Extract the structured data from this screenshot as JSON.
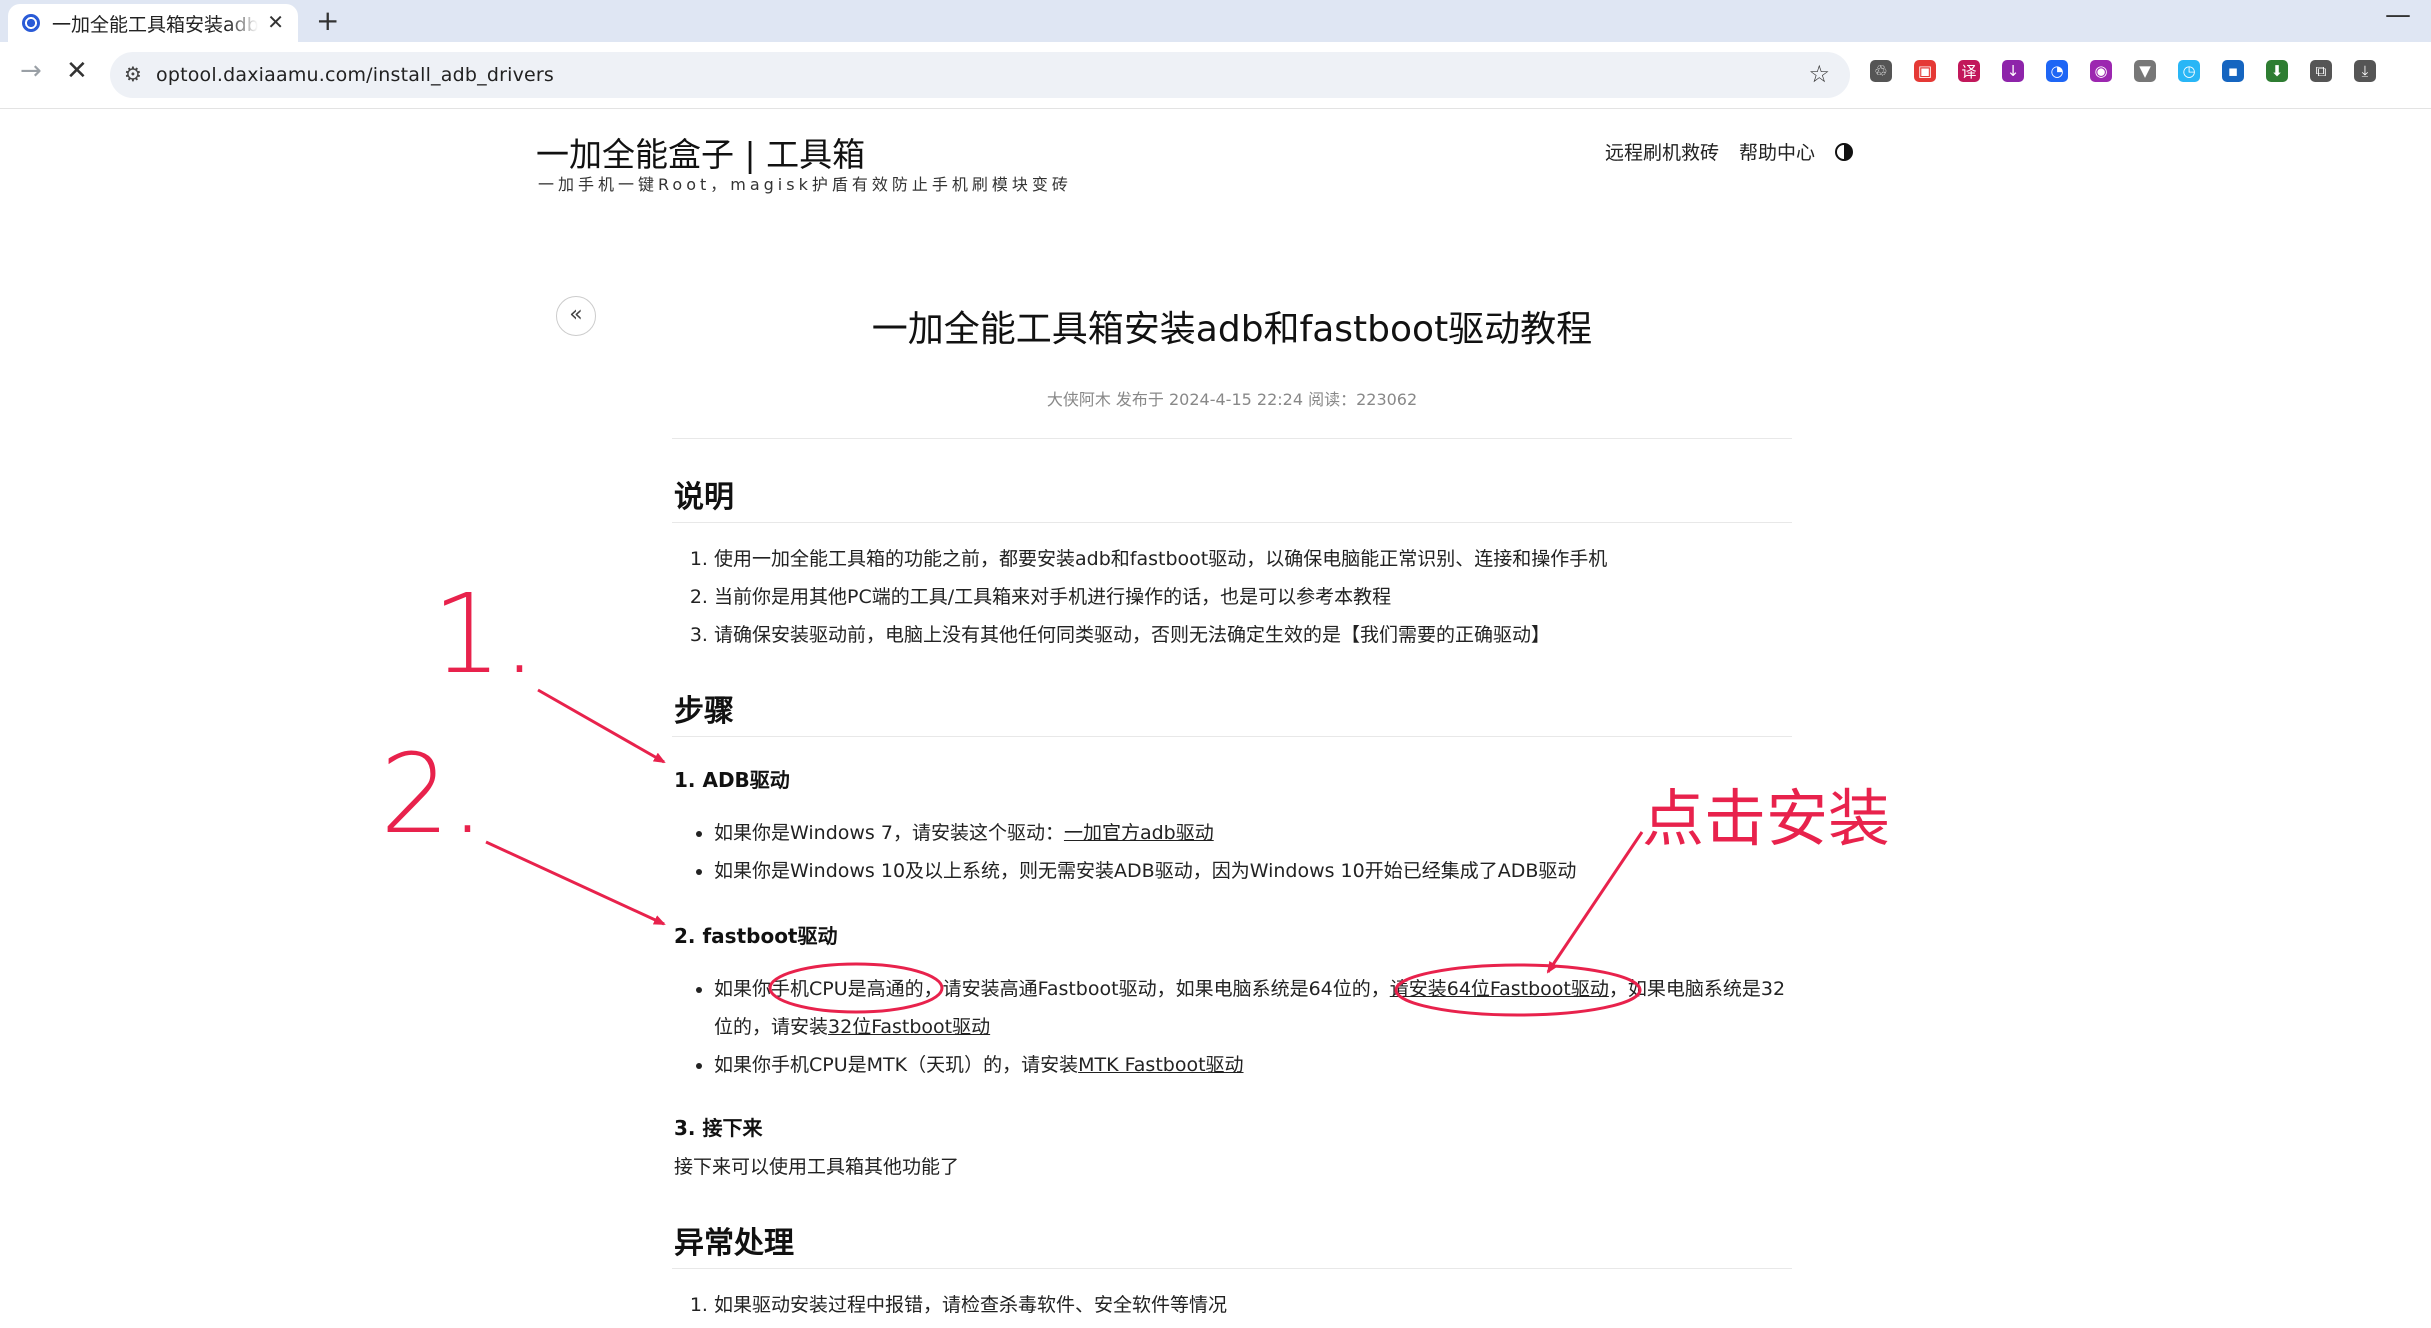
{
  "browser": {
    "tab_title": "一加全能工具箱安装adb和fastboot驱动教程",
    "tab_close": "✕",
    "new_tab": "+",
    "minimize": "—",
    "forward": "→",
    "stop": "✕",
    "site_info_icon": "⚙",
    "url": "optool.daxiaamu.com/install_adb_drivers",
    "bookmark_star": "☆",
    "extensions": [
      {
        "name": "puzzle-recycle-icon",
        "color": "#555555",
        "glyph": "♲"
      },
      {
        "name": "dice-icon",
        "color": "#e53935",
        "glyph": "▣"
      },
      {
        "name": "translate-icon",
        "color": "#c2185b",
        "glyph": "译"
      },
      {
        "name": "download-arrow-icon",
        "color": "#8e24aa",
        "glyph": "↓"
      },
      {
        "name": "chat-icon",
        "color": "#1e66f5",
        "glyph": "◔"
      },
      {
        "name": "globe-icon",
        "color": "#9c27b0",
        "glyph": "◉"
      },
      {
        "name": "vpn-icon",
        "color": "#777777",
        "glyph": "▼"
      },
      {
        "name": "speed-icon",
        "color": "#29b6f6",
        "glyph": "◷"
      },
      {
        "name": "squares-icon",
        "color": "#1565c0",
        "glyph": "▪"
      },
      {
        "name": "green-download-icon",
        "color": "#2e7d32",
        "glyph": "⬇"
      },
      {
        "name": "extensions-icon",
        "color": "#555555",
        "glyph": "⧉"
      },
      {
        "name": "downloads-icon",
        "color": "#555555",
        "glyph": "⤓"
      }
    ]
  },
  "site": {
    "title": "一加全能盒子 | 工具箱",
    "subtitle": "一加手机一键Root，magisk护盾有效防止手机刷模块变砖",
    "nav": [
      "远程刷机救砖",
      "帮助中心"
    ]
  },
  "article": {
    "back": "«",
    "title": "一加全能工具箱安装adb和fastboot驱动教程",
    "meta": "大侠阿木 发布于 2024-4-15 22:24  阅读：223062",
    "section_intro": "说明",
    "intro_items": [
      "使用一加全能工具箱的功能之前，都要安装adb和fastboot驱动，以确保电脑能正常识别、连接和操作手机",
      "当前你是用其他PC端的工具/工具箱来对手机进行操作的话，也是可以参考本教程",
      "请确保安装驱动前，电脑上没有其他任何同类驱动，否则无法确定生效的是【我们需要的正确驱动】"
    ],
    "section_steps": "步骤",
    "step1_title": "1. ADB驱动",
    "step1_a_text": "如果你是Windows 7，请安装这个驱动：",
    "step1_a_link": "一加官方adb驱动",
    "step1_b_text": "如果你是Windows 10及以上系统，则无需安装ADB驱动，因为Windows 10开始已经集成了ADB驱动",
    "step2_title": "2. fastboot驱动",
    "step2_a_text1": "如果你手机CPU是高通的，请安装高通Fastboot驱动，如果电脑系统是64位的，",
    "step2_a_link1": "请安装64位Fastboot驱动",
    "step2_a_text2": "，如果电脑系统是32位的，请安装",
    "step2_a_link2": "32位Fastboot驱动",
    "step2_b_text": "如果你手机CPU是MTK（天玑）的，请安装",
    "step2_b_link": "MTK Fastboot驱动",
    "step3_title": "3. 接下来",
    "step3_text": "接下来可以使用工具箱其他功能了",
    "section_issues": "异常处理",
    "issue_items": [
      "如果驱动安装过程中报错，请检查杀毒软件、安全软件等情况"
    ]
  },
  "annotations": {
    "num1": "1.",
    "num2": "2.",
    "click_install": "点击安装",
    "color": "#e8224c"
  }
}
